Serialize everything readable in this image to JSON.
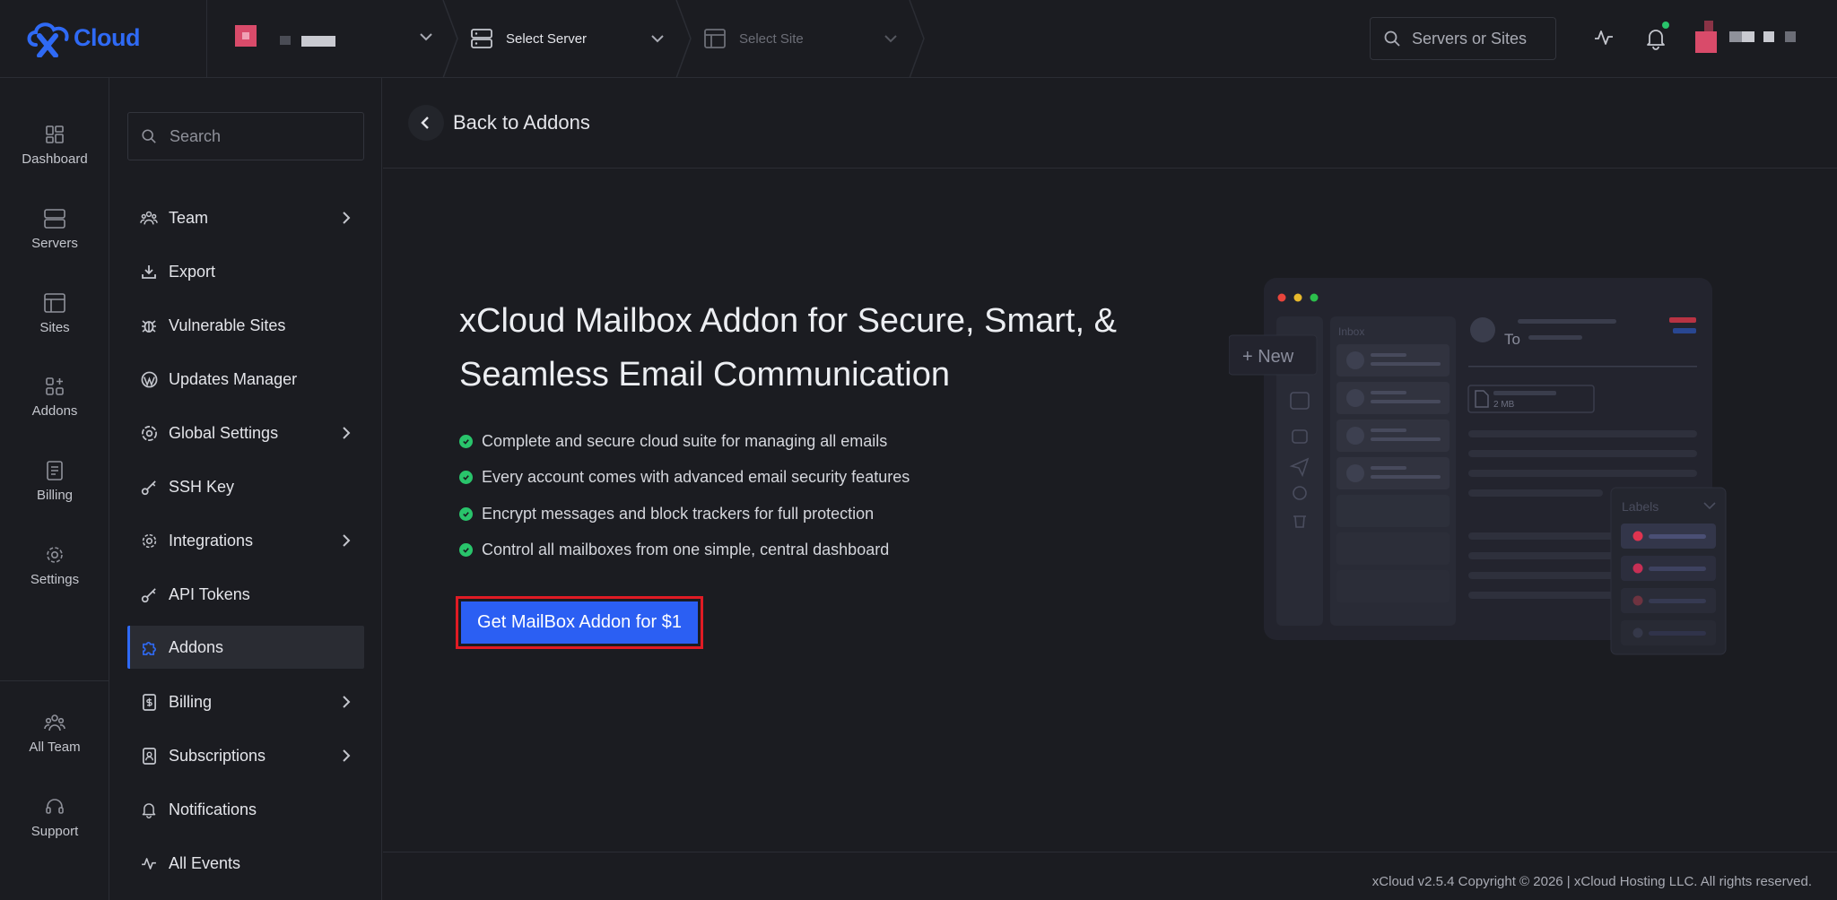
{
  "app": {
    "logo_text": "Cloud"
  },
  "topbar": {
    "server_label": "Select Server",
    "site_label": "Select Site",
    "search_placeholder": "Servers or Sites"
  },
  "rail": {
    "dashboard": "Dashboard",
    "servers": "Servers",
    "sites": "Sites",
    "addons": "Addons",
    "billing": "Billing",
    "settings": "Settings",
    "all_team": "All Team",
    "support": "Support"
  },
  "menu": {
    "search_placeholder": "Search",
    "items": [
      {
        "label": "Team",
        "icon": "team-icon",
        "chevron": true
      },
      {
        "label": "Export",
        "icon": "download-icon",
        "chevron": false
      },
      {
        "label": "Vulnerable Sites",
        "icon": "bug-icon",
        "chevron": false
      },
      {
        "label": "Updates Manager",
        "icon": "wordpress-icon",
        "chevron": false
      },
      {
        "label": "Global Settings",
        "icon": "globe-settings-icon",
        "chevron": true
      },
      {
        "label": "SSH Key",
        "icon": "key-icon",
        "chevron": false
      },
      {
        "label": "Integrations",
        "icon": "gear-icon",
        "chevron": true
      },
      {
        "label": "API Tokens",
        "icon": "key-icon",
        "chevron": false
      },
      {
        "label": "Addons",
        "icon": "puzzle-icon",
        "chevron": false,
        "active": true
      },
      {
        "label": "Billing",
        "icon": "invoice-icon",
        "chevron": true
      },
      {
        "label": "Subscriptions",
        "icon": "subscription-icon",
        "chevron": true
      },
      {
        "label": "Notifications",
        "icon": "bell-icon",
        "chevron": false
      },
      {
        "label": "All Events",
        "icon": "activity-icon",
        "chevron": false
      }
    ]
  },
  "main": {
    "back_label": "Back to Addons",
    "headline_line1": "xCloud Mailbox Addon for Secure, Smart, &",
    "headline_line2": "Seamless Email Communication",
    "features": [
      "Complete and secure cloud suite for managing all emails",
      "Every account comes with advanced email security features",
      "Encrypt messages and block trackers for full protection",
      "Control all mailboxes from one simple, central dashboard"
    ],
    "cta_label": "Get MailBox Addon for $1"
  },
  "illustration": {
    "new_label": "New",
    "inbox_label": "Inbox",
    "to_label": "To",
    "file_size": "2 MB",
    "labels_title": "Labels"
  },
  "footer": {
    "text": "xCloud v2.5.4 Copyright © 2026 | xCloud Hosting LLC. All rights reserved."
  },
  "colors": {
    "accent": "#2b5ff3",
    "success": "#29c46b",
    "highlight": "#e01b24",
    "background": "#1b1c21"
  }
}
